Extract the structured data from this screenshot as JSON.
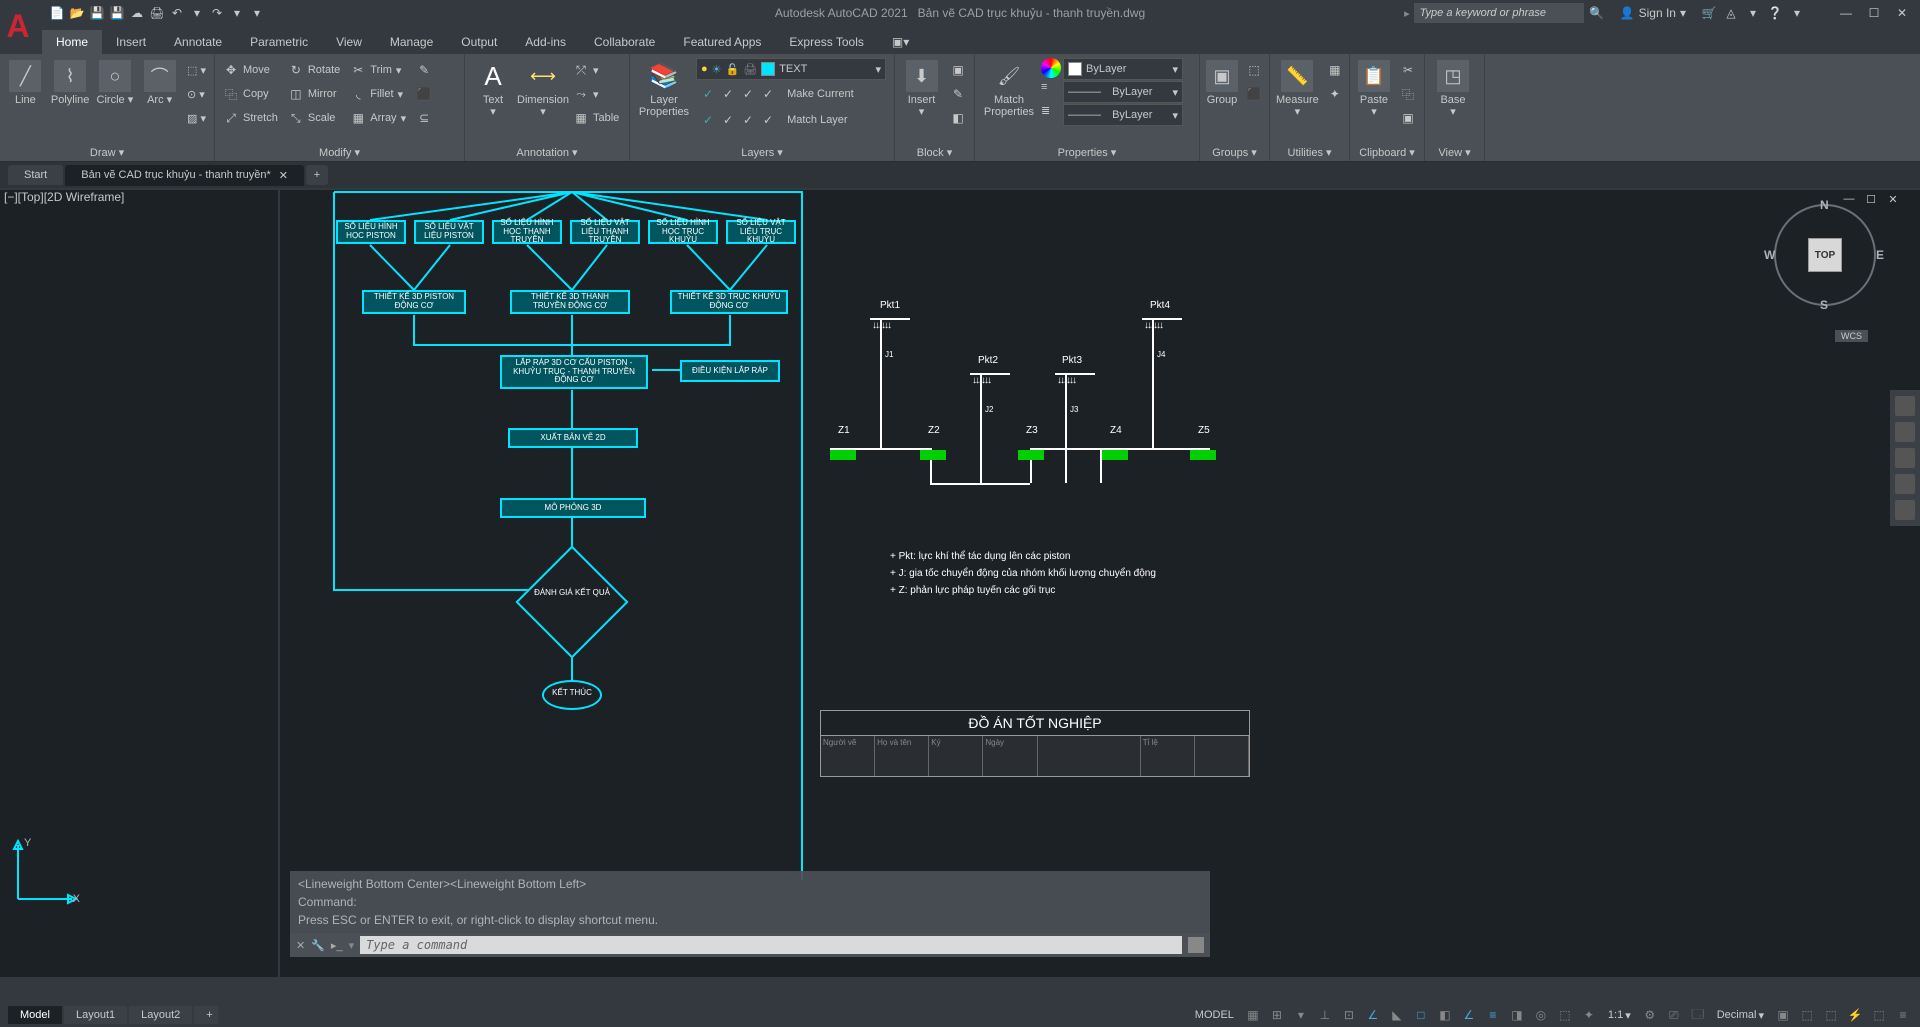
{
  "app": {
    "title_prefix": "Autodesk AutoCAD 2021",
    "filename": "Bản vẽ CAD trục khuỷu - thanh truyền.dwg",
    "logo": "A"
  },
  "quick_access": [
    "new-icon",
    "open-icon",
    "save-icon",
    "saveas-icon",
    "plot-icon",
    "undo-icon",
    "redo-icon"
  ],
  "search": {
    "placeholder": "Type a keyword or phrase"
  },
  "account": {
    "signin": "Sign In"
  },
  "menu_tabs": [
    "Home",
    "Insert",
    "Annotate",
    "Parametric",
    "View",
    "Manage",
    "Output",
    "Add-ins",
    "Collaborate",
    "Featured Apps",
    "Express Tools"
  ],
  "ribbon": {
    "draw": {
      "title": "Draw",
      "items": [
        "Line",
        "Polyline",
        "Circle",
        "Arc"
      ]
    },
    "modify": {
      "title": "Modify",
      "rows": [
        [
          "Move",
          "Rotate",
          "Trim"
        ],
        [
          "Copy",
          "Mirror",
          "Fillet"
        ],
        [
          "Stretch",
          "Scale",
          "Array"
        ]
      ]
    },
    "annotation": {
      "title": "Annotation",
      "items": [
        "Text",
        "Dimension",
        "Table"
      ]
    },
    "layers": {
      "title": "Layers",
      "big": "Layer\nProperties",
      "current": "TEXT",
      "rows": [
        "Make Current",
        "Match Layer"
      ]
    },
    "block": {
      "title": "Block",
      "big": "Insert"
    },
    "properties": {
      "title": "Properties",
      "big": "Match\nProperties",
      "layer": "ByLayer",
      "lw": "ByLayer",
      "lt": "ByLayer"
    },
    "groups": {
      "title": "Groups",
      "big": "Group"
    },
    "utilities": {
      "title": "Utilities",
      "big": "Measure"
    },
    "clipboard": {
      "title": "Clipboard",
      "big": "Paste"
    },
    "view": {
      "title": "View",
      "big": "Base"
    }
  },
  "file_tabs": {
    "start": "Start",
    "current": "Bản vẽ CAD trục khuỷu - thanh truyền*"
  },
  "viewport": {
    "label": "[−][Top][2D Wireframe]",
    "cube": "TOP",
    "wcs": "WCS",
    "n": "N",
    "e": "E",
    "s": "S",
    "w": "W"
  },
  "flowchart": {
    "row1": [
      "SỐ LIỆU HÌNH HỌC PISTON",
      "SỐ LIỆU VẬT LIỆU PISTON",
      "SỐ LIỆU HÌNH HỌC THANH TRUYỀN",
      "SỐ LIỆU VẬT LIỆU THANH TRUYỀN",
      "SỐ LIỆU HÌNH HỌC TRỤC KHUỶU",
      "SỐ LIỆU VẬT LIỆU TRỤC KHUỶU"
    ],
    "row2": [
      "THIẾT KẾ 3D PISTON ĐỘNG CƠ",
      "THIẾT KẾ 3D THANH TRUYỀN ĐỘNG CƠ",
      "THIẾT KẾ 3D TRỤC KHUỶU ĐỘNG CƠ"
    ],
    "assembly": "LẮP RÁP 3D CƠ CẤU PISTON - KHUỶU TRỤC - THANH TRUYỀN ĐỘNG CƠ",
    "cond": "ĐIỀU KIỆN LẮP RÁP",
    "export": "XUẤT BẢN VẼ 2D",
    "sim": "MÔ PHỎNG 3D",
    "eval": "ĐÁNH GIÁ KẾT QUẢ",
    "end": "KẾT THÚC"
  },
  "schematic": {
    "pkt": [
      "Pkt1",
      "Pkt2",
      "Pkt3",
      "Pkt4"
    ],
    "j": [
      "J1",
      "J2",
      "J3",
      "J4"
    ],
    "z": [
      "Z1",
      "Z2",
      "Z3",
      "Z4",
      "Z5"
    ]
  },
  "notes": {
    "l1": "+ Pkt: lực khí thể tác dụng lên các piston",
    "l2": "+ J: gia tốc chuyển động của nhóm khối lượng chuyển động",
    "l3": "+ Z: phản lực pháp tuyến các gối trục"
  },
  "title_block": {
    "title": "ĐỒ ÁN TỐT NGHIỆP",
    "cells": [
      "Người vẽ",
      "Họ và tên",
      "Ký",
      "Ngày",
      "",
      "Tỉ lệ",
      ""
    ]
  },
  "cmd": {
    "hist1": "<Lineweight Bottom Center><Lineweight Bottom Left>",
    "hist2": "Command:",
    "hist3": "Press ESC or ENTER to exit, or right-click to display shortcut menu.",
    "placeholder": "Type a command"
  },
  "layout_tabs": [
    "Model",
    "Layout1",
    "Layout2"
  ],
  "statusbar": {
    "model": "MODEL",
    "scale": "1:1",
    "decimal": "Decimal"
  }
}
